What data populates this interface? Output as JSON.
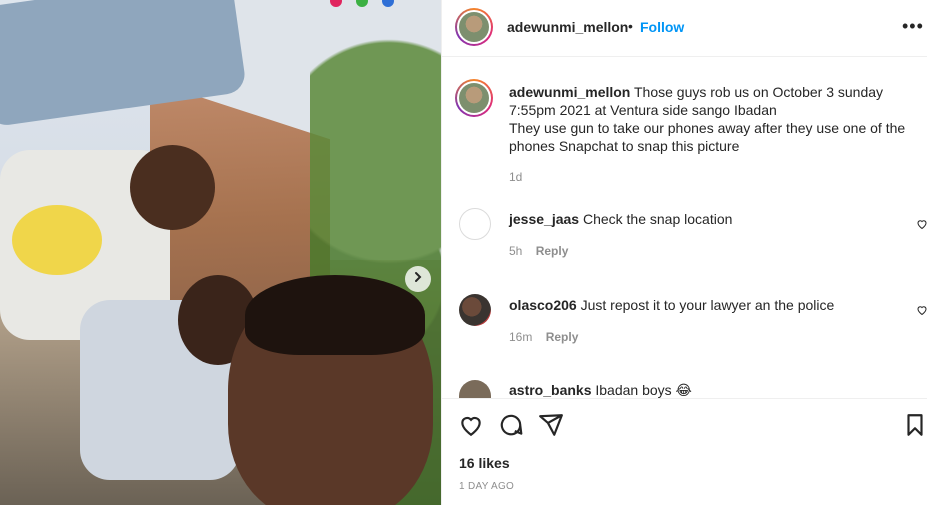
{
  "post": {
    "username": "adewunmi_mellon",
    "separator": "•",
    "follow_label": "Follow",
    "more_label": "•••"
  },
  "caption": {
    "username": "adewunmi_mellon",
    "text": "Those guys rob us on October 3 sunday 7:55pm 2021 at Ventura side sango Ibadan",
    "text2": "They use gun to take our phones away after they use one of the phones Snapchat to snap this picture",
    "time": "1d"
  },
  "comments": [
    {
      "username": "jesse_jaas",
      "text": "Check the snap location",
      "time": "5h",
      "reply": "Reply"
    },
    {
      "username": "olasco206",
      "text": "Just repost it to your lawyer an the police",
      "time": "16m",
      "reply": "Reply"
    },
    {
      "username": "astro_banks",
      "text": "Ibadan boys 😂"
    }
  ],
  "actions": {
    "likes": "16 likes",
    "date": "1 DAY AGO"
  },
  "icons": {
    "next": "chevron-right-icon",
    "heart": "heart-icon",
    "comment": "comment-icon",
    "share": "share-icon",
    "save": "bookmark-icon"
  }
}
